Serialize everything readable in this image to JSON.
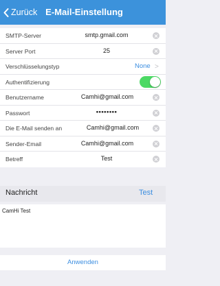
{
  "nav": {
    "back_label": "Zurück",
    "title": "E-Mail-Einstellung"
  },
  "form": {
    "smtp_server": {
      "label": "SMTP-Server",
      "value": "smtp.gmail.com"
    },
    "server_port": {
      "label": "Server Port",
      "value": "25"
    },
    "encryption": {
      "label": "Verschlüsselungstyp",
      "value": "None"
    },
    "authentication": {
      "label": "Authentifizierung",
      "enabled": true
    },
    "username": {
      "label": "Benutzername",
      "value": "Camhi@gmail.com"
    },
    "password": {
      "label": "Passwort",
      "value": "••••••••"
    },
    "send_to": {
      "label": "Die E-Mail senden an",
      "value": "Camhi@gmail.com"
    },
    "sender": {
      "label": "Sender-Email",
      "value": "Camhi@gmail.com"
    },
    "subject": {
      "label": "Betreff",
      "value": "Test"
    }
  },
  "message": {
    "label": "Nachricht",
    "test_label": "Test",
    "text": "CamHi Test"
  },
  "apply_label": "Anwenden",
  "colors": {
    "nav_bg": "#3c92db",
    "accent": "#3c8ee0",
    "toggle_on": "#4cd964"
  }
}
